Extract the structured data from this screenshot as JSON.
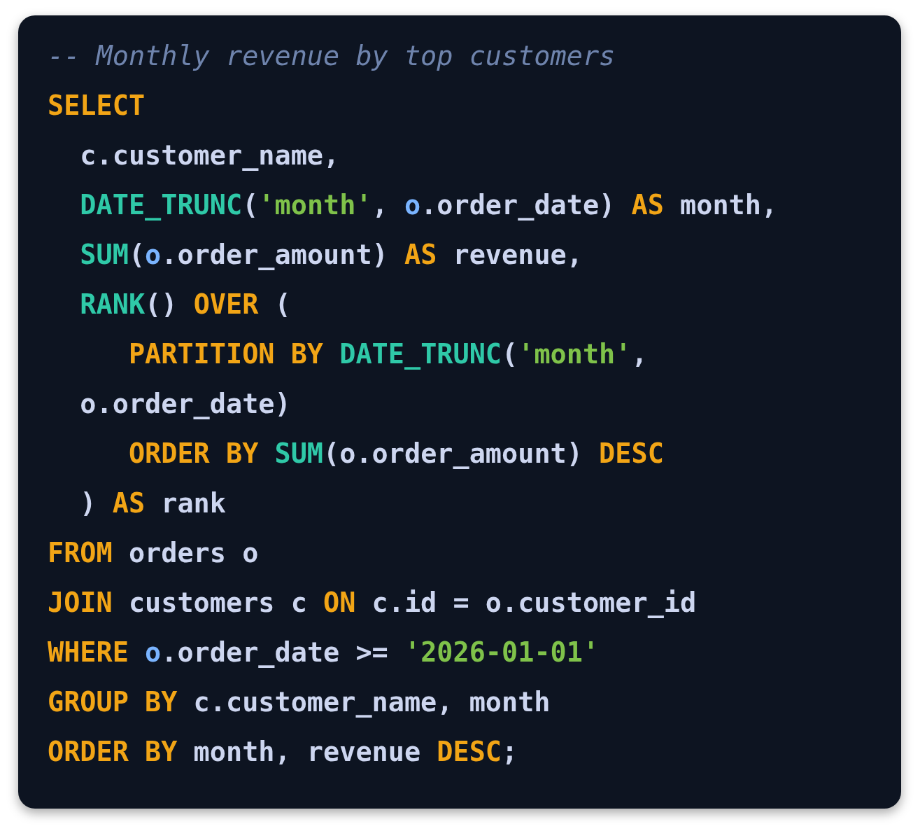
{
  "code_lines": [
    {
      "tokens": [
        {
          "kind": "comment",
          "text": "-- Monthly revenue by top customers"
        }
      ]
    },
    {
      "tokens": [
        {
          "kind": "keyword",
          "text": "SELECT"
        }
      ]
    },
    {
      "tokens": [
        {
          "kind": "plain",
          "text": "  c.customer_name,"
        }
      ]
    },
    {
      "tokens": [
        {
          "kind": "function",
          "text": "  DATE_TRUNC"
        },
        {
          "kind": "plain",
          "text": "("
        },
        {
          "kind": "string",
          "text": "'month'"
        },
        {
          "kind": "plain",
          "text": ", "
        },
        {
          "kind": "alias",
          "text": "o"
        },
        {
          "kind": "plain",
          "text": ".order_date) "
        },
        {
          "kind": "keyword",
          "text": "AS"
        },
        {
          "kind": "plain",
          "text": " month,"
        }
      ]
    },
    {
      "tokens": [
        {
          "kind": "function",
          "text": "  SUM"
        },
        {
          "kind": "plain",
          "text": "("
        },
        {
          "kind": "alias",
          "text": "o"
        },
        {
          "kind": "plain",
          "text": ".order_amount) "
        },
        {
          "kind": "keyword",
          "text": "AS"
        },
        {
          "kind": "plain",
          "text": " revenue,"
        }
      ]
    },
    {
      "tokens": [
        {
          "kind": "function",
          "text": "  RANK"
        },
        {
          "kind": "plain",
          "text": "() "
        },
        {
          "kind": "keyword",
          "text": "OVER"
        },
        {
          "kind": "plain",
          "text": " ("
        }
      ]
    },
    {
      "tokens": [
        {
          "kind": "keyword",
          "text": "     PARTITION BY "
        },
        {
          "kind": "function",
          "text": "DATE_TRUNC"
        },
        {
          "kind": "plain",
          "text": "("
        },
        {
          "kind": "string",
          "text": "'month'"
        },
        {
          "kind": "plain",
          "text": ","
        }
      ]
    },
    {
      "tokens": [
        {
          "kind": "plain",
          "text": "  o.order_date)"
        }
      ]
    },
    {
      "tokens": [
        {
          "kind": "keyword",
          "text": "     ORDER BY "
        },
        {
          "kind": "function",
          "text": "SUM"
        },
        {
          "kind": "plain",
          "text": "(o.order_amount) "
        },
        {
          "kind": "keyword",
          "text": "DESC"
        }
      ]
    },
    {
      "tokens": [
        {
          "kind": "plain",
          "text": "  ) "
        },
        {
          "kind": "keyword",
          "text": "AS"
        },
        {
          "kind": "plain",
          "text": " rank"
        }
      ]
    },
    {
      "tokens": [
        {
          "kind": "keyword",
          "text": "FROM"
        },
        {
          "kind": "plain",
          "text": " orders o"
        }
      ]
    },
    {
      "tokens": [
        {
          "kind": "keyword",
          "text": "JOIN"
        },
        {
          "kind": "plain",
          "text": " customers c "
        },
        {
          "kind": "keyword",
          "text": "ON"
        },
        {
          "kind": "plain",
          "text": " c.id = o.customer_id"
        }
      ]
    },
    {
      "tokens": [
        {
          "kind": "keyword",
          "text": "WHERE "
        },
        {
          "kind": "alias",
          "text": "o"
        },
        {
          "kind": "plain",
          "text": ".order_date >= "
        },
        {
          "kind": "string",
          "text": "'2026-01-01'"
        }
      ]
    },
    {
      "tokens": [
        {
          "kind": "keyword",
          "text": "GROUP BY"
        },
        {
          "kind": "plain",
          "text": " c.customer_name, month"
        }
      ]
    },
    {
      "tokens": [
        {
          "kind": "keyword",
          "text": "ORDER BY"
        },
        {
          "kind": "plain",
          "text": " month, revenue "
        },
        {
          "kind": "keyword",
          "text": "DESC"
        },
        {
          "kind": "plain",
          "text": ";"
        }
      ]
    }
  ]
}
